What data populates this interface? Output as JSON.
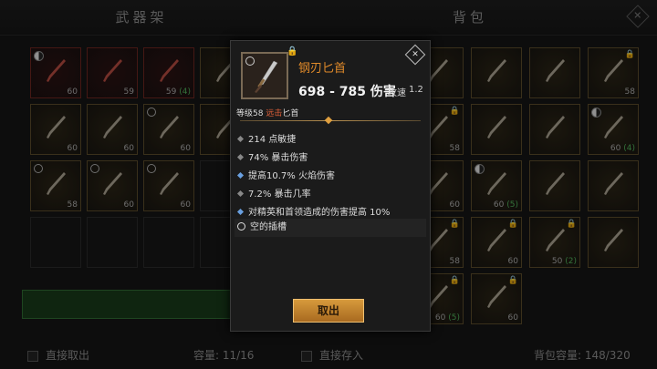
{
  "left_panel": {
    "title": "武器架",
    "bottom_checkbox_label": "直接取出",
    "capacity_label": "容量: 11/16",
    "slots": [
      {
        "kind": "red",
        "mark": "yy",
        "level": "60",
        "socket": ""
      },
      {
        "kind": "red",
        "mark": "",
        "level": "59",
        "socket": ""
      },
      {
        "kind": "red",
        "mark": "",
        "level": "59",
        "socket": "(4)"
      },
      {
        "kind": "gold",
        "mark": "",
        "level": "",
        "socket": ""
      },
      {
        "kind": "gold",
        "mark": "",
        "level": "60",
        "socket": ""
      },
      {
        "kind": "gold",
        "mark": "",
        "level": "60",
        "socket": ""
      },
      {
        "kind": "gold",
        "mark": "ring",
        "level": "60",
        "socket": ""
      },
      {
        "kind": "gold",
        "mark": "",
        "level": "",
        "socket": ""
      },
      {
        "kind": "gold",
        "mark": "ring",
        "level": "58",
        "socket": ""
      },
      {
        "kind": "gold",
        "mark": "ring",
        "level": "60",
        "socket": ""
      },
      {
        "kind": "gold",
        "mark": "ring",
        "level": "60",
        "socket": ""
      },
      {
        "kind": "empty",
        "mark": "",
        "level": "",
        "socket": ""
      },
      {
        "kind": "empty",
        "mark": "",
        "level": "",
        "socket": ""
      },
      {
        "kind": "empty",
        "mark": "",
        "level": "",
        "socket": ""
      },
      {
        "kind": "empty",
        "mark": "",
        "level": "",
        "socket": ""
      },
      {
        "kind": "empty",
        "mark": "",
        "level": "",
        "socket": ""
      }
    ]
  },
  "right_panel": {
    "title": "背包",
    "bottom_checkbox_label": "直接存入",
    "capacity_label": "背包容量: 148/320",
    "slots": [
      {
        "kind": "gold",
        "mark": "",
        "level": "",
        "socket": ""
      },
      {
        "kind": "gold",
        "mark": "",
        "level": "",
        "socket": ""
      },
      {
        "kind": "gold",
        "mark": "",
        "level": "",
        "socket": ""
      },
      {
        "kind": "gold",
        "mark": "lock",
        "level": "58",
        "socket": ""
      },
      {
        "kind": "gold",
        "mark": "lock",
        "level": "58",
        "socket": ""
      },
      {
        "kind": "gold",
        "mark": "",
        "level": "",
        "socket": ""
      },
      {
        "kind": "gold",
        "mark": "",
        "level": "",
        "socket": ""
      },
      {
        "kind": "gold",
        "mark": "yy",
        "level": "60",
        "socket": "(4)"
      },
      {
        "kind": "gold",
        "mark": "",
        "level": "60",
        "socket": ""
      },
      {
        "kind": "gold",
        "mark": "yy",
        "level": "60",
        "socket": "(5)"
      },
      {
        "kind": "gold",
        "mark": "",
        "level": "",
        "socket": ""
      },
      {
        "kind": "gold",
        "mark": "",
        "level": "",
        "socket": ""
      },
      {
        "kind": "gold",
        "mark": "lock",
        "level": "58",
        "socket": ""
      },
      {
        "kind": "gold",
        "mark": "lock",
        "level": "60",
        "socket": ""
      },
      {
        "kind": "gold",
        "mark": "lock",
        "level": "50",
        "socket": "(2)"
      },
      {
        "kind": "gold",
        "mark": "",
        "level": "",
        "socket": ""
      },
      {
        "kind": "gold",
        "mark": "lock",
        "level": "60",
        "socket": "(5)"
      },
      {
        "kind": "gold",
        "mark": "lock",
        "level": "60",
        "socket": ""
      }
    ]
  },
  "tooltip": {
    "item_name": "钢刃匕首",
    "damage": "698 - 785 伤害",
    "speed_label": "攻速",
    "speed_value": "1.2",
    "level_prefix": "等级58",
    "level_range": "远击",
    "level_type": "匕首",
    "stats": [
      {
        "text": "214 点敏捷",
        "bullet": "grey"
      },
      {
        "text": "74% 暴击伤害",
        "bullet": "grey"
      },
      {
        "text": "提高10.7% 火焰伤害",
        "bullet": "blue"
      },
      {
        "text": "7.2% 暴击几率",
        "bullet": "grey"
      },
      {
        "text": "对精英和首领造成的伤害提高 10%",
        "bullet": "blue"
      }
    ],
    "empty_socket": "空的插槽",
    "take_button": "取出",
    "close_glyph": "✕"
  },
  "colors": {
    "item_name": "#e08a2a",
    "range_type": "#e0603a",
    "button": "#c8862e"
  }
}
